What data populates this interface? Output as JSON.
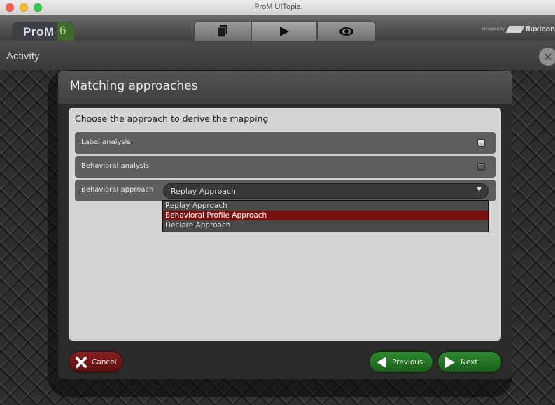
{
  "window": {
    "title": "ProM UITopia"
  },
  "app": {
    "logo_text": "ProM",
    "logo_version": "6",
    "tabs": [
      {
        "icon": "documents-icon"
      },
      {
        "icon": "play-icon"
      },
      {
        "icon": "eye-icon"
      }
    ],
    "credit_small": "designed by",
    "credit_brand": "fluxicon"
  },
  "activity": {
    "title": "Activity",
    "close_icon": "close-circle-icon"
  },
  "dialog": {
    "title": "Matching approaches",
    "prompt": "Choose the approach to derive the mapping",
    "rows": [
      {
        "label": "Label analysis",
        "checked": false
      },
      {
        "label": "Behavioral analysis",
        "checked": true
      },
      {
        "label": "Behavioral approach"
      }
    ],
    "combo": {
      "value": "Replay Approach",
      "options": [
        "Replay Approach",
        "Behavioral Profile Approach",
        "Declare Approach"
      ],
      "highlighted": "Behavioral Profile Approach"
    },
    "buttons": {
      "cancel": "Cancel",
      "previous": "Previous",
      "next": "Next"
    }
  },
  "colors": {
    "cancel": "#7a1a1a",
    "nav": "#237323",
    "highlight": "#7a1010"
  }
}
